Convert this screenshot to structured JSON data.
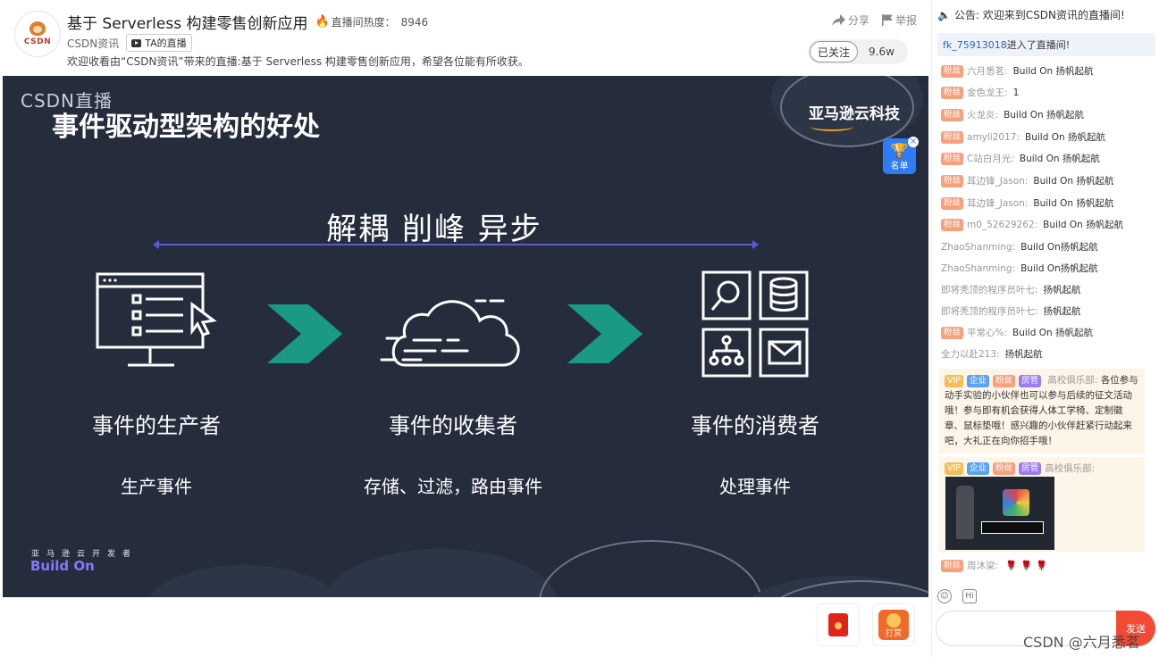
{
  "header": {
    "avatar_brand": "CSDN",
    "title": "基于 Serverless 构建零售创新应用",
    "heat_label": "直播间热度：",
    "heat_value": "8946",
    "author": "CSDN资讯",
    "ta_live_label": "TA的直播",
    "description": "欢迎收看由“CSDN资讯”带来的直播:基于 Serverless 构建零售创新应用，希望各位能有所收获。",
    "share_label": "分享",
    "report_label": "举报",
    "followed_label": "已关注",
    "fans_count": "9.6w"
  },
  "slide": {
    "watermark": "CSDN直播",
    "title": "事件驱动型架构的好处",
    "aws_label": "亚马逊云科技",
    "rank_label": "名单",
    "rank_close": "×",
    "tagline": "解耦 削峰 异步",
    "stages": [
      {
        "label": "事件的生产者",
        "sub": "生产事件"
      },
      {
        "label": "事件的收集者",
        "sub": "存储、过滤，路由事件"
      },
      {
        "label": "事件的消费者",
        "sub": "处理事件"
      }
    ],
    "dev_label": "亚马逊云开发者",
    "build_on": "Build On"
  },
  "bottom": {
    "tip_label": "打赏"
  },
  "sidebar": {
    "announcement": "公告: 欢迎来到CSDN资讯的直播间!",
    "enter_user": "fk_75913018",
    "enter_text": " 进入了直播间!",
    "fan_badge": "粉丝",
    "vip_badge": "VIP",
    "ent_badge": "企业",
    "mgr_badge": "房管",
    "messages": [
      {
        "fan": true,
        "user": "六月悉茗:",
        "text": "Build On 扬帆起航"
      },
      {
        "fan": true,
        "user": "金色龙王:",
        "text": "1"
      },
      {
        "fan": true,
        "user": "火龙炎:",
        "text": "Build On 扬帆起航"
      },
      {
        "fan": true,
        "user": "amyli2017:",
        "text": "Build On 扬帆起航"
      },
      {
        "fan": true,
        "user": "C站白月光:",
        "text": "Build On 扬帆起航"
      },
      {
        "fan": true,
        "user": "耳边锋_Jason:",
        "text": "Build On 扬帆起航"
      },
      {
        "fan": true,
        "user": "耳边锋_Jason:",
        "text": "Build On 扬帆起航"
      },
      {
        "fan": true,
        "user": "m0_52629262:",
        "text": "Build On 扬帆起航"
      },
      {
        "fan": false,
        "user": "ZhaoShanming:",
        "text": "Build On扬帆起航"
      },
      {
        "fan": false,
        "user": "ZhaoShanming:",
        "text": "Build On扬帆起航"
      },
      {
        "fan": false,
        "user": "即将秃顶的程序员叶七:",
        "text": "扬帆起航"
      },
      {
        "fan": false,
        "user": "即将秃顶的程序员叶七:",
        "text": "扬帆起航"
      },
      {
        "fan": true,
        "user": "平常心%:",
        "text": "Build On 扬帆起航"
      },
      {
        "fan": false,
        "user": "全力以赴213:",
        "text": "扬帆起航"
      }
    ],
    "club_user": "高校俱乐部:",
    "club_message": "各位参与动手实验的小伙伴也可以参与后续的征文活动哦！参与即有机会获得人体工学椅、定制徽章、鼠标垫哦！感兴趣的小伙伴赶紧行动起来吧，大礼正在向你招手哦！",
    "last_user": "周沐梁:",
    "last_text": "🌹🌹🌹",
    "tool_emoji": "☺",
    "tool_hi": "Hi",
    "send_label": "发送",
    "watermark": "CSDN @六月悉茗"
  }
}
